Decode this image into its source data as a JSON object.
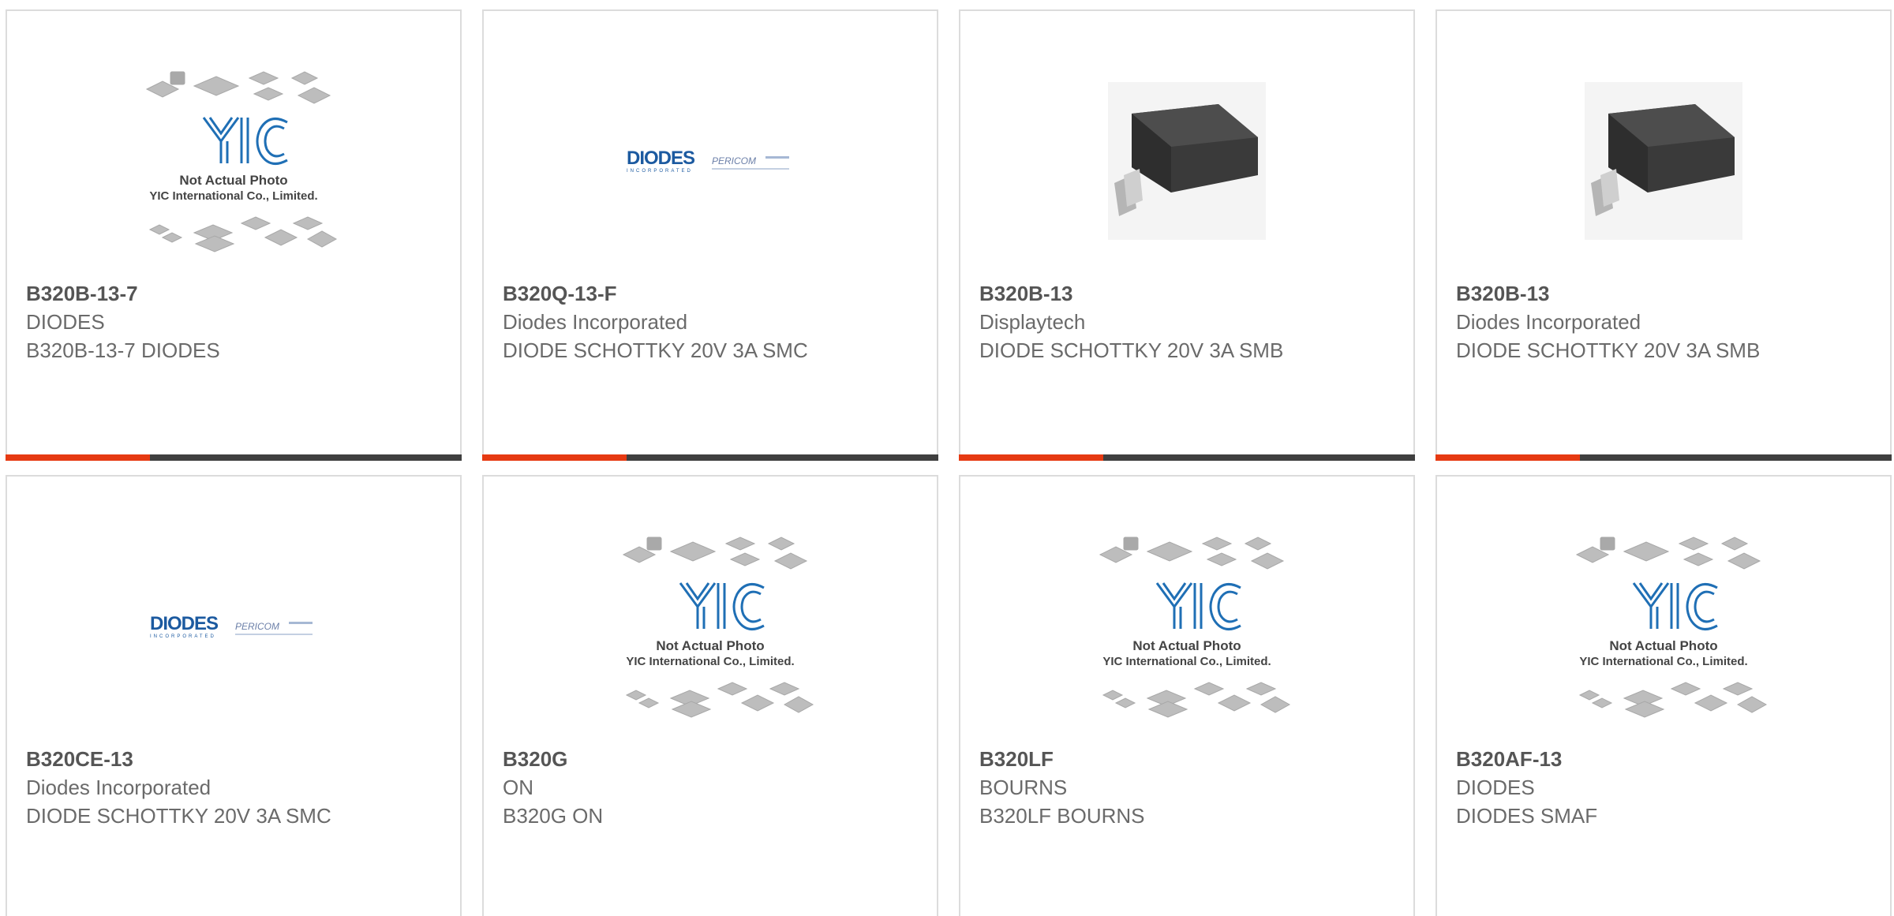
{
  "products": [
    {
      "part": "B320B-13-7",
      "manufacturer": "DIODES",
      "description": "B320B-13-7 DIODES",
      "image": "yic-placeholder"
    },
    {
      "part": "B320Q-13-F",
      "manufacturer": "Diodes Incorporated",
      "description": "DIODE SCHOTTKY 20V 3A SMC",
      "image": "diodes-logo"
    },
    {
      "part": "B320B-13",
      "manufacturer": "Displaytech",
      "description": "DIODE SCHOTTKY 20V 3A SMB",
      "image": "smb-package"
    },
    {
      "part": "B320B-13",
      "manufacturer": "Diodes Incorporated",
      "description": "DIODE SCHOTTKY 20V 3A SMB",
      "image": "smb-package"
    },
    {
      "part": "B320CE-13",
      "manufacturer": "Diodes Incorporated",
      "description": "DIODE SCHOTTKY 20V 3A SMC",
      "image": "diodes-logo"
    },
    {
      "part": "B320G",
      "manufacturer": "ON",
      "description": "B320G ON",
      "image": "yic-placeholder"
    },
    {
      "part": "B320LF",
      "manufacturer": "BOURNS",
      "description": "B320LF BOURNS",
      "image": "yic-placeholder"
    },
    {
      "part": "B320AF-13",
      "manufacturer": "DIODES",
      "description": "DIODES SMAF",
      "image": "yic-placeholder"
    }
  ],
  "placeholder": {
    "line1": "Not Actual Photo",
    "line2": "YIC International Co., Limited.",
    "logo": "YIC"
  },
  "diodes_logo": {
    "brand": "DIODES",
    "tagline": "INCORPORATED",
    "partner": "PERICOM"
  },
  "colors": {
    "accent": "#e63a12",
    "bar": "#3f3f3f",
    "title": "#555555",
    "text": "#6a6a6a",
    "border": "#dcdcdc",
    "yic_blue": "#1f6fb5",
    "diodes_blue": "#1c5aa0"
  }
}
